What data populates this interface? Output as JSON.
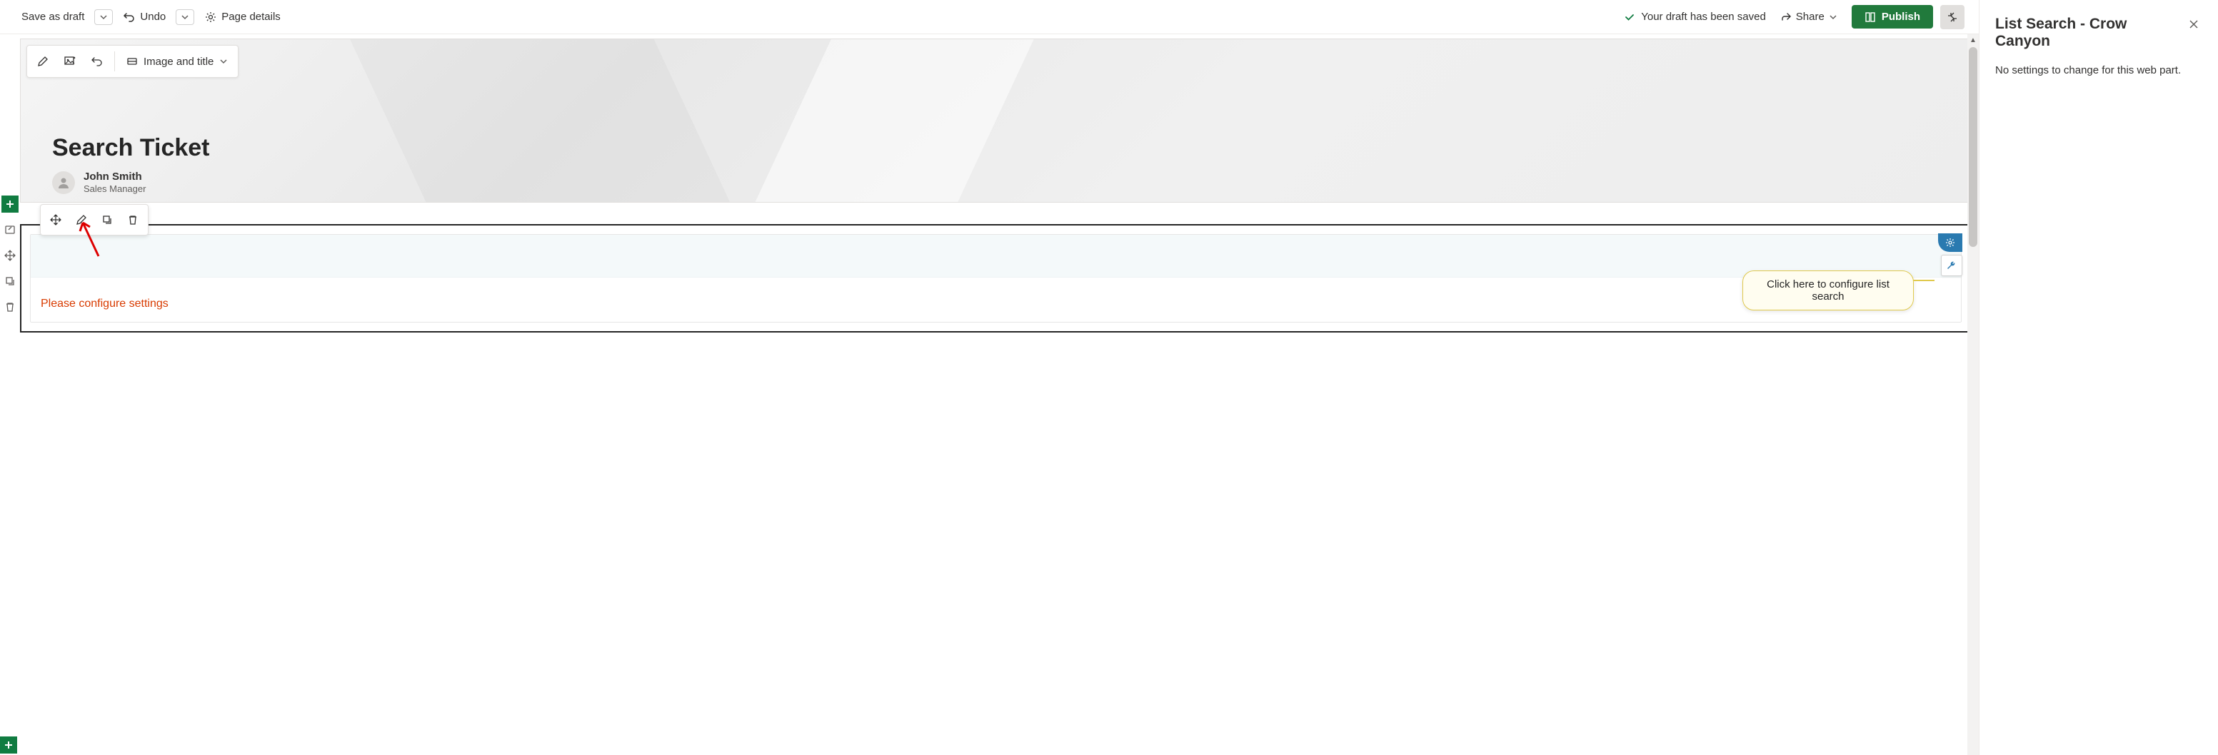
{
  "toolbar": {
    "save_draft": "Save as draft",
    "undo": "Undo",
    "page_details": "Page details",
    "saved_message": "Your draft has been saved",
    "share": "Share",
    "publish": "Publish"
  },
  "hero": {
    "layout_dropdown": "Image and title",
    "title": "Search Ticket",
    "author_name": "John Smith",
    "author_role": "Sales Manager"
  },
  "webpart": {
    "error_text": "Please configure settings",
    "callout_text": "Click here to configure list search"
  },
  "panel": {
    "title": "List Search - Crow Canyon",
    "body": "No settings to change for this web part."
  }
}
